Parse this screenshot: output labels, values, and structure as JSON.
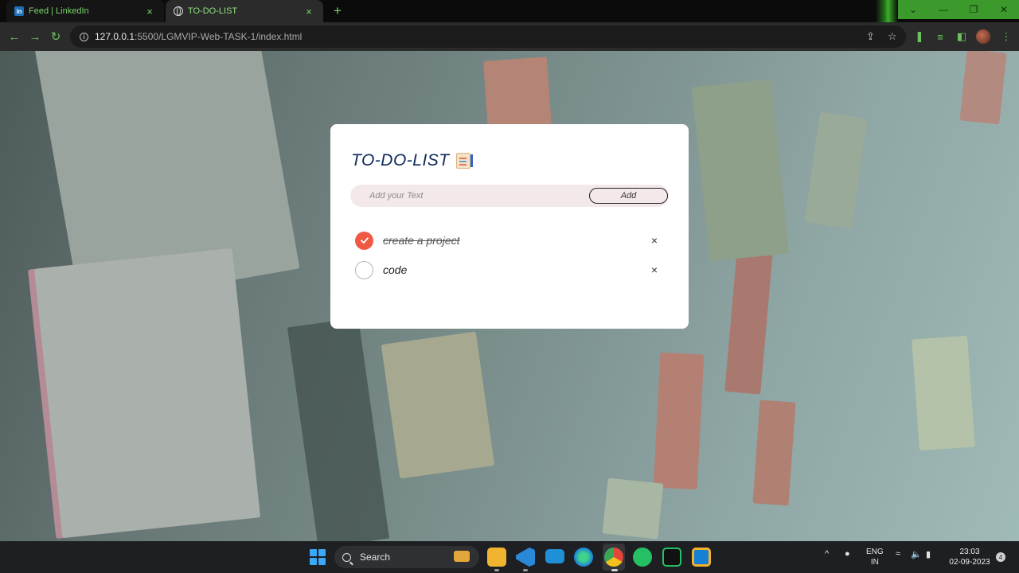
{
  "browser": {
    "tabs": [
      {
        "title": "Feed | LinkedIn",
        "icon": "linkedin-icon",
        "close": "×"
      },
      {
        "title": "TO-DO-LIST",
        "icon": "globe-icon",
        "close": "×"
      }
    ],
    "new_tab": "+",
    "url_host": "127.0.0.1",
    "url_path": ":5500/LGMVIP-Web-TASK-1/index.html",
    "window_controls": {
      "dropdown": "⌄",
      "minimize": "—",
      "restore": "❐",
      "close": "✕"
    },
    "accent_color": "#6cc15e"
  },
  "todo": {
    "title": "TO-DO-LIST",
    "input_placeholder": "Add your Text",
    "add_label": "Add",
    "tasks": [
      {
        "text": "create a project",
        "done": true,
        "remove": "×"
      },
      {
        "text": "code",
        "done": false,
        "remove": "×"
      }
    ],
    "check_color": "#ef5a45",
    "title_color": "#0f2a5c"
  },
  "taskbar": {
    "search_label": "Search",
    "lang_top": "ENG",
    "lang_bottom": "IN",
    "time": "23:03",
    "date": "02-09-2023",
    "notification_count": "4",
    "tray_chevron": "^"
  }
}
